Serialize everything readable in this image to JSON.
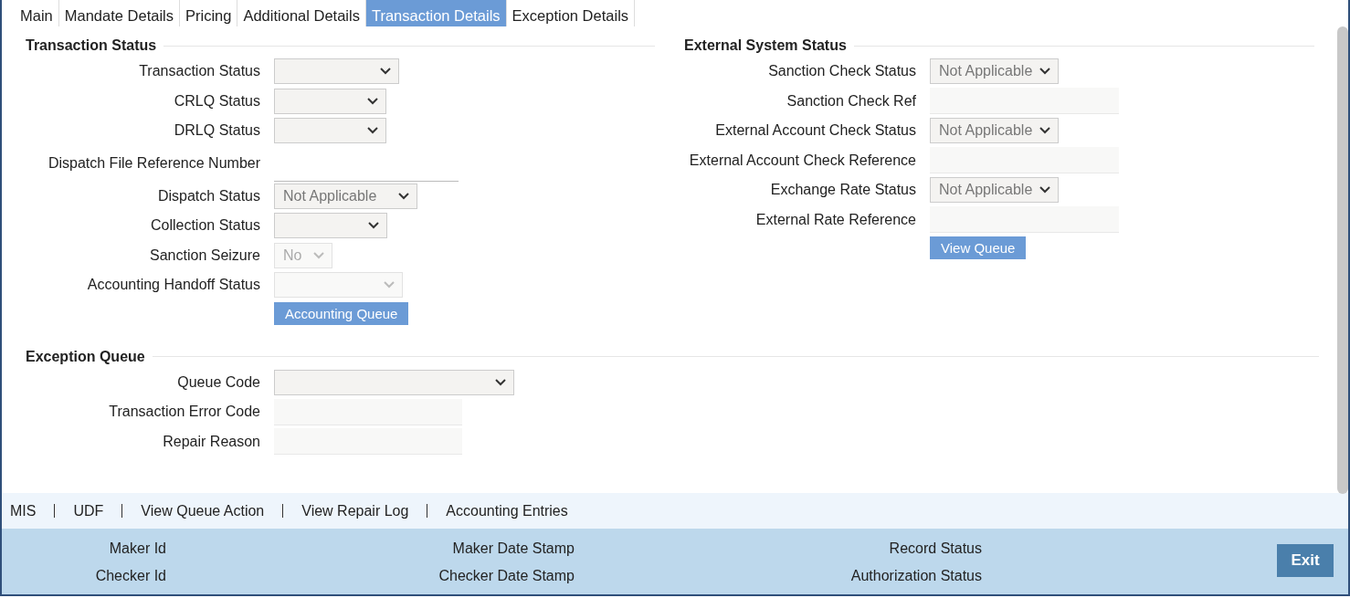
{
  "tabs": [
    {
      "label": "Main",
      "selected": false
    },
    {
      "label": "Mandate Details",
      "selected": false
    },
    {
      "label": "Pricing",
      "selected": false
    },
    {
      "label": "Additional Details",
      "selected": false
    },
    {
      "label": "Transaction Details",
      "selected": true
    },
    {
      "label": "Exception Details",
      "selected": false
    }
  ],
  "transaction_status": {
    "title": "Transaction Status",
    "fields": [
      {
        "label": "Transaction Status",
        "kind": "select",
        "disabled": false
      },
      {
        "label": "CRLQ Status",
        "kind": "select",
        "disabled": false
      },
      {
        "label": "DRLQ Status",
        "kind": "select",
        "disabled": false
      },
      {
        "label": "Dispatch File Reference Number",
        "kind": "line"
      },
      {
        "label": "Dispatch Status",
        "kind": "select",
        "value": "Not Applicable",
        "disabled": false
      },
      {
        "label": "Collection Status",
        "kind": "select",
        "disabled": false
      },
      {
        "label": "Sanction Seizure",
        "kind": "select",
        "value": "No",
        "disabled": true
      },
      {
        "label": "Accounting Handoff Status",
        "kind": "select",
        "disabled": true
      }
    ],
    "button": "Accounting Queue"
  },
  "external_system_status": {
    "title": "External System Status",
    "fields": [
      {
        "label": "Sanction Check Status",
        "kind": "select",
        "value": "Not Applicable",
        "disabled": false
      },
      {
        "label": "Sanction Check Ref",
        "kind": "text"
      },
      {
        "label": "External Account Check Status",
        "kind": "select",
        "value": "Not Applicable",
        "disabled": false
      },
      {
        "label": "External Account Check Reference",
        "kind": "text"
      },
      {
        "label": "Exchange Rate Status",
        "kind": "select",
        "value": "Not Applicable",
        "disabled": false
      },
      {
        "label": "External Rate Reference",
        "kind": "text"
      }
    ],
    "button": "View Queue"
  },
  "exception_queue": {
    "title": "Exception Queue",
    "fields": [
      {
        "label": "Queue Code",
        "kind": "select",
        "disabled": false
      },
      {
        "label": "Transaction Error Code",
        "kind": "text"
      },
      {
        "label": "Repair Reason",
        "kind": "text"
      }
    ]
  },
  "links": [
    "MIS",
    "UDF",
    "View Queue Action",
    "View Repair Log",
    "Accounting Entries"
  ],
  "audit": [
    "Maker Id",
    "Maker Date Stamp",
    "Record Status",
    "Checker Id",
    "Checker Date Stamp",
    "Authorization Status"
  ],
  "exit_button": "Exit"
}
